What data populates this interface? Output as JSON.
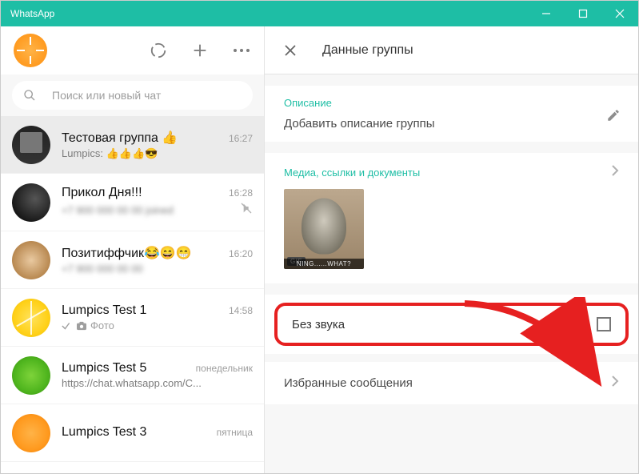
{
  "app_title": "WhatsApp",
  "search": {
    "placeholder": "Поиск или новый чат"
  },
  "chats": [
    {
      "name": "Тестовая группа 👍",
      "time": "16:27",
      "preview": "Lumpics: 👍👍👍😎",
      "selected": true,
      "muted": false,
      "avatar": "monitor"
    },
    {
      "name": "Прикол Дня!!!",
      "time": "16:28",
      "preview": "+7 900 000 00 00 joined",
      "selected": false,
      "muted": true,
      "blurred": true,
      "avatar": "dark"
    },
    {
      "name": "Позитиффчик😂😄😁",
      "time": "16:20",
      "preview": "+7 900 000 00 00",
      "selected": false,
      "muted": false,
      "blurred": true,
      "avatar": "kitty"
    },
    {
      "name": "Lumpics Test 1",
      "time": "14:58",
      "preview_icon": true,
      "preview": "Фото",
      "selected": false,
      "muted": false,
      "avatar": "lemon"
    },
    {
      "name": "Lumpics Test 5",
      "time": "понедельник",
      "preview": "https://chat.whatsapp.com/C...",
      "selected": false,
      "muted": false,
      "avatar": "lime"
    },
    {
      "name": "Lumpics Test 3",
      "time": "пятница",
      "preview": "",
      "selected": false,
      "muted": false,
      "avatar": "orange2"
    }
  ],
  "panel": {
    "title": "Данные группы",
    "description_label": "Описание",
    "description_placeholder": "Добавить описание группы",
    "media_label": "Медиа, ссылки и документы",
    "gif_badge": "GIF",
    "media_caption": "NING......WHAT?",
    "mute_label": "Без звука",
    "starred_label": "Избранные сообщения"
  }
}
